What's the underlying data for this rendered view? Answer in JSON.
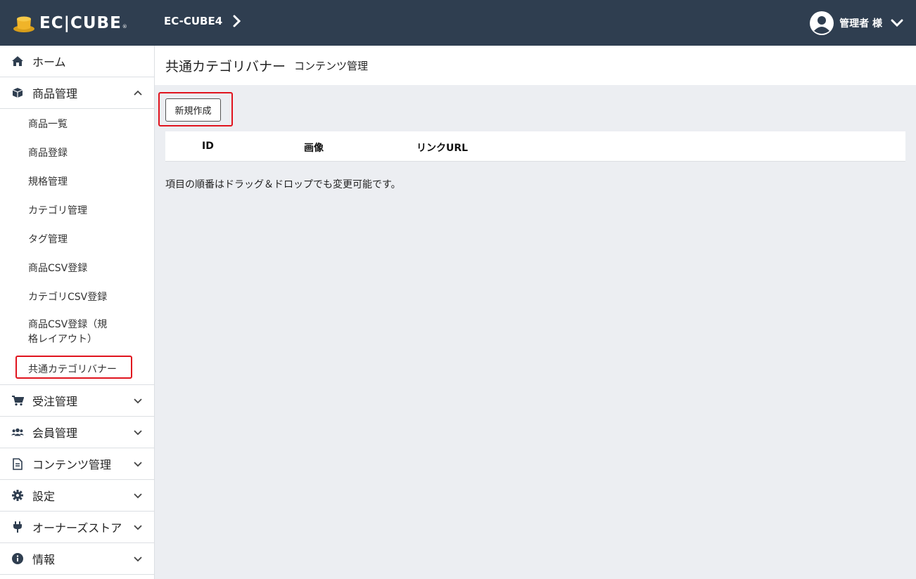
{
  "header": {
    "logo_text": "EC|CUBE",
    "shop_name": "EC-CUBE4",
    "user_name": "管理者 様"
  },
  "sidebar": {
    "items": [
      {
        "label": "ホーム",
        "icon": "home-icon"
      },
      {
        "label": "商品管理",
        "icon": "box-icon",
        "expanded": true
      },
      {
        "label": "受注管理",
        "icon": "cart-icon"
      },
      {
        "label": "会員管理",
        "icon": "users-icon"
      },
      {
        "label": "コンテンツ管理",
        "icon": "file-icon"
      },
      {
        "label": "設定",
        "icon": "gear-icon"
      },
      {
        "label": "オーナーズストア",
        "icon": "plug-icon"
      },
      {
        "label": "情報",
        "icon": "info-icon"
      }
    ],
    "product_sub": [
      "商品一覧",
      "商品登録",
      "規格管理",
      "カテゴリ管理",
      "タグ管理",
      "商品CSV登録",
      "カテゴリCSV登録",
      "商品CSV登録（規格レイアウト）",
      "共通カテゴリバナー"
    ]
  },
  "main": {
    "title": "共通カテゴリバナー",
    "subtitle": "コンテンツ管理",
    "new_button": "新規作成",
    "columns": [
      "ID",
      "画像",
      "リンクURL"
    ],
    "note": "項目の順番はドラッグ＆ドロップでも変更可能です。"
  },
  "colors": {
    "header_bg": "#2f3e50",
    "highlight": "#e0141e",
    "logo_gold": "#f0b429"
  }
}
